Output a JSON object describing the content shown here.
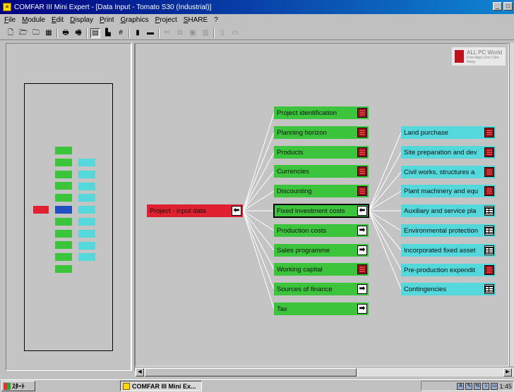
{
  "window": {
    "title": "COMFAR III Mini Expert - [Data Input - Tomato S30 (Industrial)]",
    "controls": [
      "_",
      "□"
    ]
  },
  "menu": [
    "File",
    "Module",
    "Edit",
    "Display",
    "Print",
    "Graphics",
    "Project",
    "SHARE",
    "?"
  ],
  "toolbar": {
    "buttons": [
      {
        "name": "new-icon",
        "glyph": "🗋"
      },
      {
        "name": "open-icon",
        "glyph": "🗁"
      },
      {
        "name": "open-folder-icon",
        "glyph": "🗀"
      },
      {
        "name": "save-icon",
        "glyph": "▦"
      },
      {
        "name": "print-icon",
        "glyph": "🖶"
      },
      {
        "name": "print-preview-icon",
        "glyph": "🖷"
      },
      {
        "name": "data-table-icon",
        "glyph": "▤"
      },
      {
        "name": "chart-icon",
        "glyph": "▙"
      },
      {
        "name": "grid-icon",
        "glyph": "#"
      },
      {
        "name": "book-icon",
        "glyph": "▮"
      },
      {
        "name": "folder-icon",
        "glyph": "▬"
      },
      {
        "name": "cut-icon",
        "glyph": "✂"
      },
      {
        "name": "copy-icon",
        "glyph": "⧉"
      },
      {
        "name": "paste-icon",
        "glyph": "▣"
      },
      {
        "name": "format-icon",
        "glyph": "▥"
      },
      {
        "name": "columns-icon",
        "glyph": "▯"
      },
      {
        "name": "rows-icon",
        "glyph": "▭"
      }
    ]
  },
  "watermark": {
    "text": "ALL PC World",
    "sub": "Free Apps One Click Away"
  },
  "tree": {
    "root": {
      "label": "Project - input data",
      "icon": "arrow-left"
    },
    "level1": [
      {
        "label": "Project identification",
        "icon": "red"
      },
      {
        "label": "Planning horizon",
        "icon": "red"
      },
      {
        "label": "Products",
        "icon": "red"
      },
      {
        "label": "Currencies",
        "icon": "red"
      },
      {
        "label": "Discounting",
        "icon": "red"
      },
      {
        "label": "Fixed investment costs",
        "icon": "arrow-left",
        "selected": true
      },
      {
        "label": "Production costs",
        "icon": "arrow-right"
      },
      {
        "label": "Sales programme",
        "icon": "arrow-right"
      },
      {
        "label": "Working capital",
        "icon": "red"
      },
      {
        "label": "Sources of finance",
        "icon": "arrow-right"
      },
      {
        "label": "Tax",
        "icon": "arrow-right"
      }
    ],
    "level2": [
      {
        "label": "Land purchase",
        "icon": "red"
      },
      {
        "label": "Site preparation and dev",
        "icon": "red"
      },
      {
        "label": "Civil works, structures a",
        "icon": "red"
      },
      {
        "label": "Plant machinery and equ",
        "icon": "red"
      },
      {
        "label": "Auxiliary and service pla",
        "icon": "table"
      },
      {
        "label": "Environmental protection",
        "icon": "table"
      },
      {
        "label": "Incorporated fixed asset",
        "icon": "table"
      },
      {
        "label": "Pre-production expendit",
        "icon": "red"
      },
      {
        "label": "Contingencies",
        "icon": "table"
      }
    ]
  },
  "colors": {
    "level1": "#3cc43c",
    "level2": "#54d8dc",
    "root": "#e02030",
    "selected_overview": "#2050c0"
  },
  "taskbar": {
    "start_label": "ｽﾀｰﾄ",
    "task_label": "COMFAR III Mini Ex...",
    "tray_text": "1:45"
  }
}
